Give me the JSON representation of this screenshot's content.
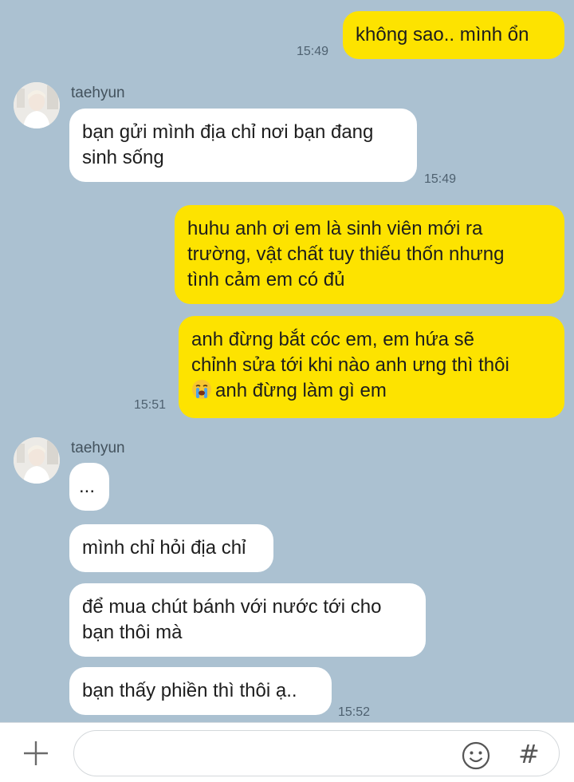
{
  "messages": {
    "m1": {
      "text": "không sao.. mình ổn",
      "time": "15:49"
    },
    "sender1": "taehyun",
    "m2": {
      "text": "bạn gửi mình địa chỉ nơi bạn đang\nsinh sống",
      "time": "15:49"
    },
    "m3": {
      "text": "huhu anh ơi em là sinh viên mới ra\ntrường, vật chất tuy thiếu thốn nhưng\ntình cảm em có đủ"
    },
    "m4": {
      "text_line1": "anh đừng bắt cóc em, em hứa sẽ",
      "text_line2": "chỉnh sửa tới khi nào anh ưng thì thôi",
      "text_line3": "anh đừng làm gì em",
      "emoji": "loudly-crying-face-icon",
      "time": "15:51"
    },
    "sender2": "taehyun",
    "m5": {
      "text": "..."
    },
    "m6": {
      "text": "mình chỉ hỏi địa chỉ"
    },
    "m7": {
      "text": "để mua chút bánh với nước tới cho\nbạn thôi mà"
    },
    "m8": {
      "text": "bạn thấy phiền thì thôi ạ..",
      "time": "15:52"
    }
  },
  "inputbar": {
    "placeholder": "",
    "plus_icon": "plus-icon",
    "emoji_icon": "smiley-icon",
    "hash_label": "#"
  },
  "colors": {
    "background": "#abc1d1",
    "outgoing_bubble": "#fde300",
    "incoming_bubble": "#ffffff"
  }
}
